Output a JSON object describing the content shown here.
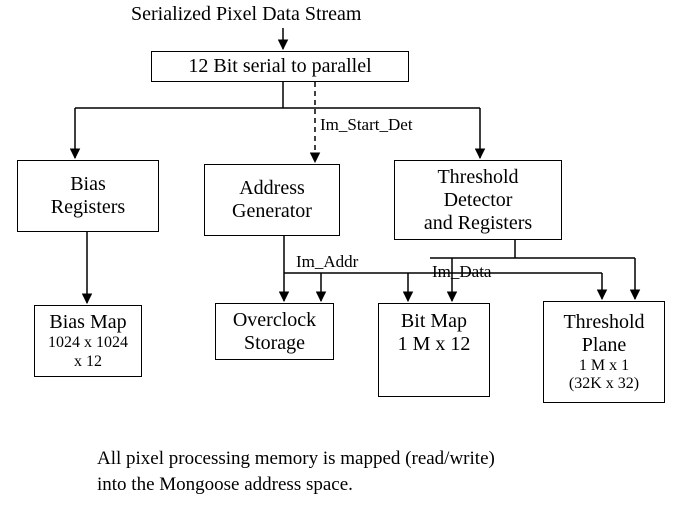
{
  "top_label": "Serialized Pixel Data Stream",
  "boxes": {
    "s2p": {
      "line1": "12 Bit serial to parallel"
    },
    "bias_reg": {
      "line1": "Bias",
      "line2": "Registers"
    },
    "addr_gen": {
      "line1": "Address",
      "line2": "Generator"
    },
    "thresh_det": {
      "line1": "Threshold",
      "line2": "Detector",
      "line3": "and Registers"
    },
    "bias_map": {
      "line1": "Bias Map",
      "line2": "1024 x 1024",
      "line3": "x 12"
    },
    "overclock": {
      "line1": "Overclock",
      "line2": "Storage"
    },
    "bitmap": {
      "line1": "Bit Map",
      "line2": "1 M x 12"
    },
    "thresh_plane": {
      "line1": "Threshold",
      "line2": "Plane",
      "line3": "1 M x 1",
      "line4": "(32K x 32)"
    }
  },
  "edges": {
    "im_start_det": "Im_Start_Det",
    "im_addr": "Im_Addr",
    "im_data": "Im_Data"
  },
  "caption": {
    "line1": "All pixel processing memory is mapped (read/write)",
    "line2": "into the Mongoose address space."
  }
}
